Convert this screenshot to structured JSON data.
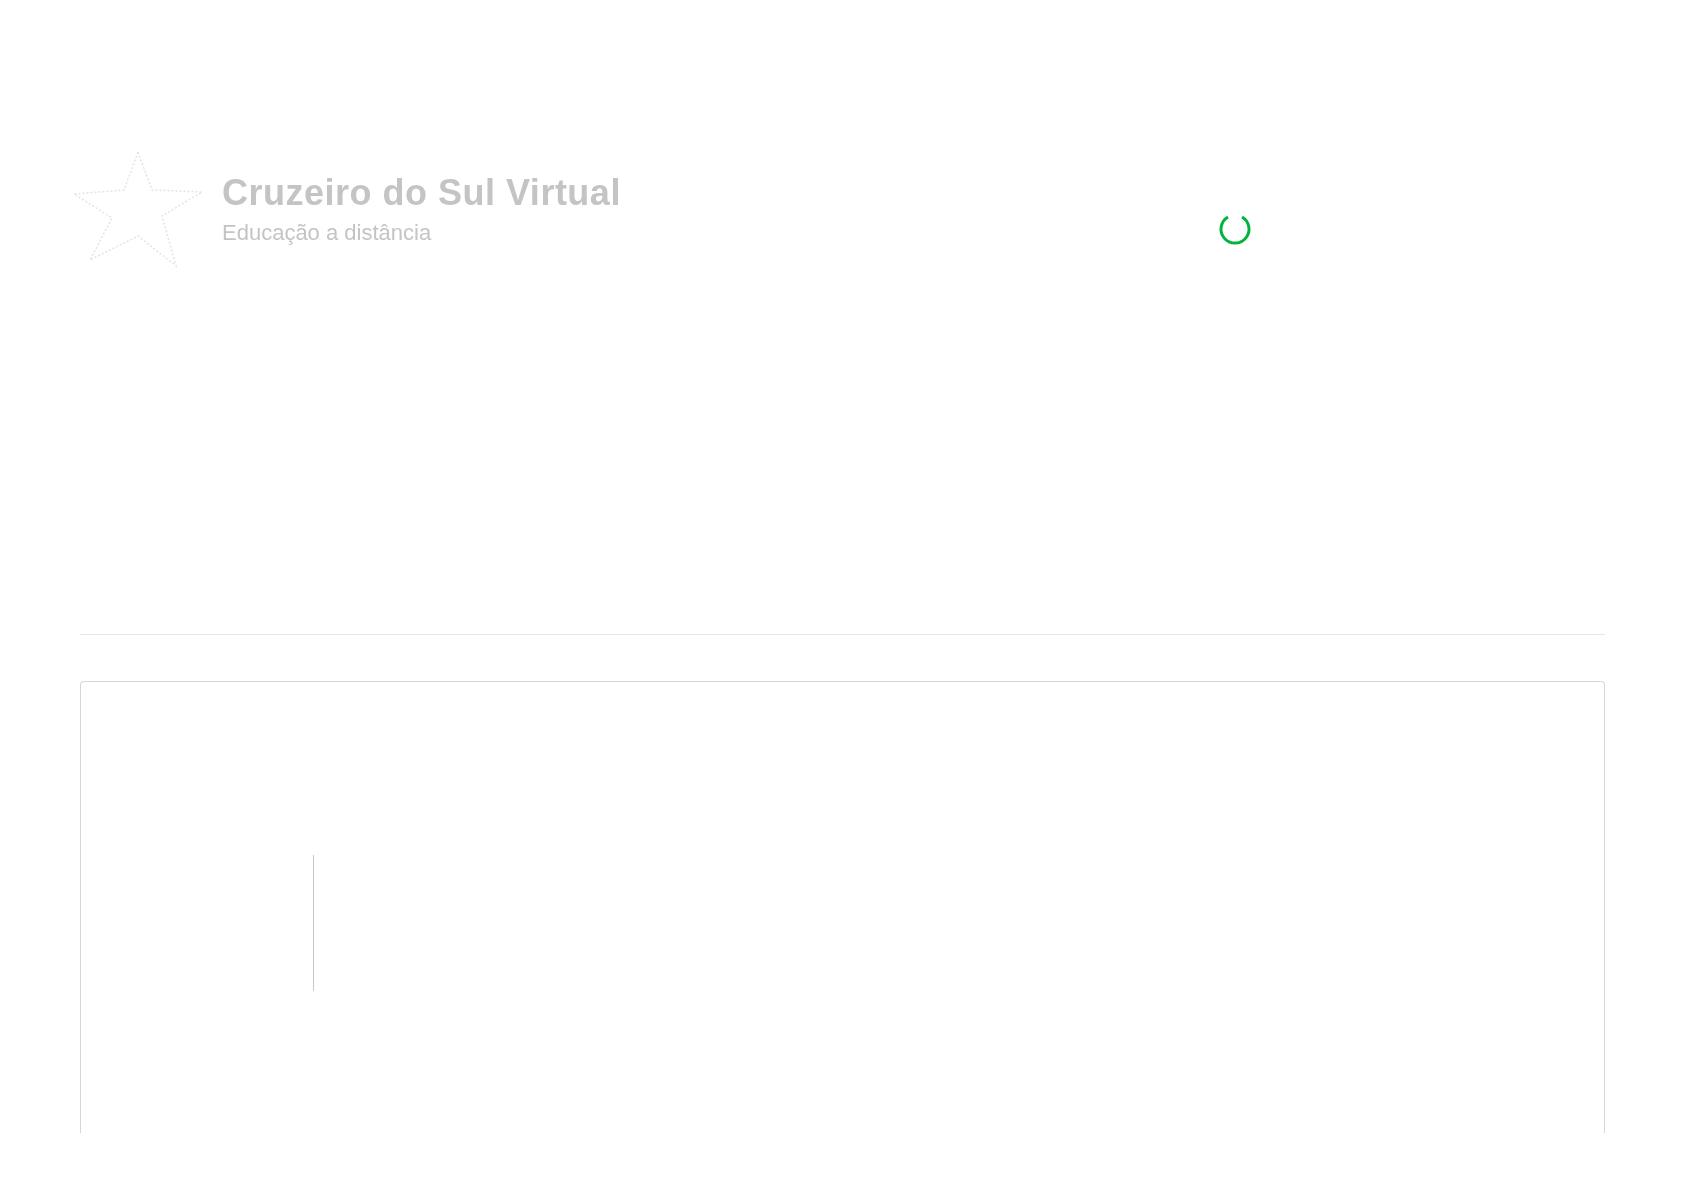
{
  "logo": {
    "title": "Cruzeiro do Sul Virtual",
    "subtitle": "Educação a distância"
  },
  "loading": {
    "spinning": true
  }
}
